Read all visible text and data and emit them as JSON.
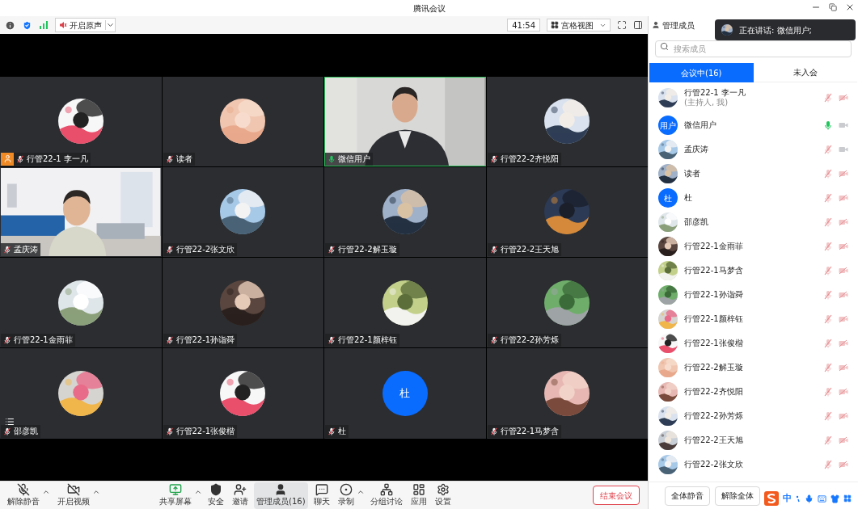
{
  "window": {
    "title": "腾讯会议"
  },
  "toolbar": {
    "audio_button": "开启原声",
    "timer": "41:54",
    "view_button": "宫格视图"
  },
  "toast": {
    "text": "正在讲话: 微信用户;"
  },
  "tiles": [
    {
      "name": "行管22-1 李一凡",
      "kind": "avatar",
      "mic_on": false,
      "speaking": false,
      "host": true
    },
    {
      "name": "读者",
      "kind": "avatar",
      "mic_on": false,
      "speaking": false,
      "host": false
    },
    {
      "name": "微信用户",
      "kind": "video",
      "mic_on": true,
      "speaking": true,
      "host": false
    },
    {
      "name": "行管22-2齐悦阳",
      "kind": "avatar",
      "mic_on": false,
      "speaking": false,
      "host": false
    },
    {
      "name": "孟庆涛",
      "kind": "video",
      "mic_on": false,
      "speaking": false,
      "host": false
    },
    {
      "name": "行管22-2张文欣",
      "kind": "avatar",
      "mic_on": false,
      "speaking": false,
      "host": false
    },
    {
      "name": "行管22-2解玉璇",
      "kind": "avatar",
      "mic_on": false,
      "speaking": false,
      "host": false
    },
    {
      "name": "行管22-2王天旭",
      "kind": "avatar",
      "mic_on": false,
      "speaking": false,
      "host": false
    },
    {
      "name": "行管22-1金雨菲",
      "kind": "avatar",
      "mic_on": false,
      "speaking": false,
      "host": false
    },
    {
      "name": "行管22-1孙诣舜",
      "kind": "avatar",
      "mic_on": false,
      "speaking": false,
      "host": false
    },
    {
      "name": "行管22-1颜梓钰",
      "kind": "avatar",
      "mic_on": false,
      "speaking": false,
      "host": false
    },
    {
      "name": "行管22-2孙芳烁",
      "kind": "avatar",
      "mic_on": false,
      "speaking": false,
      "host": false
    },
    {
      "name": "邵彦凯",
      "kind": "avatar",
      "mic_on": false,
      "speaking": false,
      "host": false
    },
    {
      "name": "行管22-1张俊楷",
      "kind": "avatar",
      "mic_on": false,
      "speaking": false,
      "host": false
    },
    {
      "name": "杜",
      "kind": "initial",
      "initial": "杜",
      "mic_on": false,
      "speaking": false,
      "host": false
    },
    {
      "name": "行管22-1马梦含",
      "kind": "avatar",
      "mic_on": false,
      "speaking": false,
      "host": false
    }
  ],
  "panel": {
    "title": "管理成员",
    "search": {
      "placeholder": "搜索成员"
    },
    "tabs": [
      {
        "label": "会议中(16)",
        "selected": true
      },
      {
        "label": "未入会",
        "selected": false
      }
    ],
    "members": [
      {
        "name": "行管22-1 李一凡",
        "role": "(主持人, 我)",
        "mic_on": false,
        "video_on": false
      },
      {
        "name": "微信用户",
        "initial": "用户",
        "mic_on": true,
        "video_on": true
      },
      {
        "name": "孟庆涛",
        "mic_on": false,
        "video_on": true
      },
      {
        "name": "读者",
        "mic_on": false,
        "video_on": false
      },
      {
        "name": "杜",
        "initial": "杜",
        "mic_on": false,
        "video_on": false
      },
      {
        "name": "邵彦凯",
        "mic_on": false,
        "video_on": false
      },
      {
        "name": "行管22-1金雨菲",
        "mic_on": false,
        "video_on": false
      },
      {
        "name": "行管22-1马梦含",
        "mic_on": false,
        "video_on": false
      },
      {
        "name": "行管22-1孙诣舜",
        "mic_on": false,
        "video_on": false
      },
      {
        "name": "行管22-1颜梓钰",
        "mic_on": false,
        "video_on": false
      },
      {
        "name": "行管22-1张俊楷",
        "mic_on": false,
        "video_on": false
      },
      {
        "name": "行管22-2解玉璇",
        "mic_on": false,
        "video_on": false
      },
      {
        "name": "行管22-2齐悦阳",
        "mic_on": false,
        "video_on": false
      },
      {
        "name": "行管22-2孙芳烁",
        "mic_on": false,
        "video_on": false
      },
      {
        "name": "行管22-2王天旭",
        "mic_on": false,
        "video_on": false
      },
      {
        "name": "行管22-2张文欣",
        "mic_on": false,
        "video_on": false
      }
    ],
    "buttons": [
      "全体静音",
      "解除全体"
    ]
  },
  "bottom_bar": {
    "items": [
      {
        "kind": "mic",
        "label": "解除静音",
        "caret": true,
        "selected": false
      },
      {
        "kind": "video",
        "label": "开启视频",
        "caret": true,
        "selected": false
      },
      {
        "kind": "share",
        "label": "共享屏幕",
        "caret": true,
        "selected": false
      },
      {
        "kind": "security",
        "label": "安全",
        "caret": false,
        "selected": false
      },
      {
        "kind": "invite",
        "label": "邀请",
        "caret": false,
        "selected": false
      },
      {
        "kind": "members",
        "label": "管理成员(16)",
        "caret": false,
        "selected": true
      },
      {
        "kind": "chat",
        "label": "聊天",
        "caret": false,
        "selected": false
      },
      {
        "kind": "record",
        "label": "录制",
        "caret": true,
        "selected": false
      },
      {
        "kind": "breakout",
        "label": "分组讨论",
        "caret": false,
        "selected": false
      },
      {
        "kind": "apps",
        "label": "应用",
        "caret": false,
        "selected": false
      },
      {
        "kind": "settings",
        "label": "设置",
        "caret": false,
        "selected": false
      }
    ],
    "end_button": "结束会议"
  },
  "ime": {
    "mode": "中"
  }
}
